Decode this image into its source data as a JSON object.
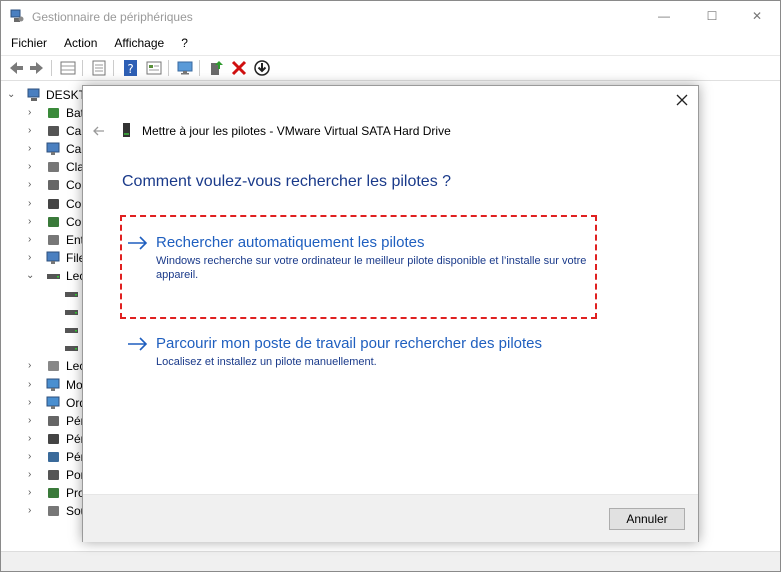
{
  "window": {
    "title": "Gestionnaire de périphériques",
    "minimize_glyph": "—",
    "maximize_glyph": "☐",
    "close_glyph": "✕"
  },
  "menubar": {
    "items": [
      "Fichier",
      "Action",
      "Affichage",
      "?"
    ]
  },
  "toolbar": {
    "icons": [
      "back-icon",
      "forward-icon",
      "properties-grid-icon",
      "list-icon",
      "help-icon",
      "details-icon",
      "monitor-icon",
      "update-driver-icon",
      "uninstall-icon",
      "download-icon"
    ]
  },
  "tree": {
    "root": "DESKTO",
    "items": [
      {
        "label": "Bat",
        "expanded": false,
        "icon": "battery-icon"
      },
      {
        "label": "Car",
        "expanded": false,
        "icon": "card-icon"
      },
      {
        "label": "Car",
        "expanded": false,
        "icon": "display-card-icon"
      },
      {
        "label": "Cla",
        "expanded": false,
        "icon": "keyboard-icon"
      },
      {
        "label": "Cor",
        "expanded": false,
        "icon": "audio-icon"
      },
      {
        "label": "Cor",
        "expanded": false,
        "icon": "usb-controller-icon"
      },
      {
        "label": "Cor",
        "expanded": false,
        "icon": "storage-controller-icon"
      },
      {
        "label": "Ent",
        "expanded": false,
        "icon": "sound-icon"
      },
      {
        "label": "File",
        "expanded": false,
        "icon": "queue-icon"
      },
      {
        "label": "Lec",
        "expanded": true,
        "icon": "drive-icon"
      },
      {
        "label": "",
        "child": true,
        "icon": "disk-icon"
      },
      {
        "label": "",
        "child": true,
        "icon": "disk-icon"
      },
      {
        "label": "",
        "child": true,
        "icon": "disk-icon"
      },
      {
        "label": "",
        "child": true,
        "icon": "disk-icon"
      },
      {
        "label": "Lec",
        "expanded": false,
        "icon": "dvd-icon"
      },
      {
        "label": "Mo",
        "expanded": false,
        "icon": "monitor-icon"
      },
      {
        "label": "Ord",
        "expanded": false,
        "icon": "computer-icon"
      },
      {
        "label": "Pér",
        "expanded": false,
        "icon": "peripheral-icon"
      },
      {
        "label": "Pér",
        "expanded": false,
        "icon": "portable-icon"
      },
      {
        "label": "Pér",
        "expanded": false,
        "icon": "system-icon"
      },
      {
        "label": "Por",
        "expanded": false,
        "icon": "port-icon"
      },
      {
        "label": "Pro",
        "expanded": false,
        "icon": "processor-icon"
      },
      {
        "label": "Sou",
        "expanded": false,
        "icon": "mouse-icon"
      }
    ]
  },
  "dialog": {
    "close_glyph": "✕",
    "header": "Mettre à jour les pilotes - VMware Virtual SATA Hard Drive",
    "question": "Comment voulez-vous rechercher les pilotes ?",
    "option_auto": {
      "title": "Rechercher automatiquement les pilotes",
      "description": "Windows recherche sur votre ordinateur le meilleur pilote disponible et l’installe sur votre appareil."
    },
    "option_manual": {
      "title": "Parcourir mon poste de travail pour rechercher des pilotes",
      "description": "Localisez et installez un pilote manuellement."
    },
    "cancel_label": "Annuler"
  },
  "colors": {
    "accent": "#1f5fbf",
    "highlight_border": "#e02020",
    "question": "#1a3a8a"
  }
}
